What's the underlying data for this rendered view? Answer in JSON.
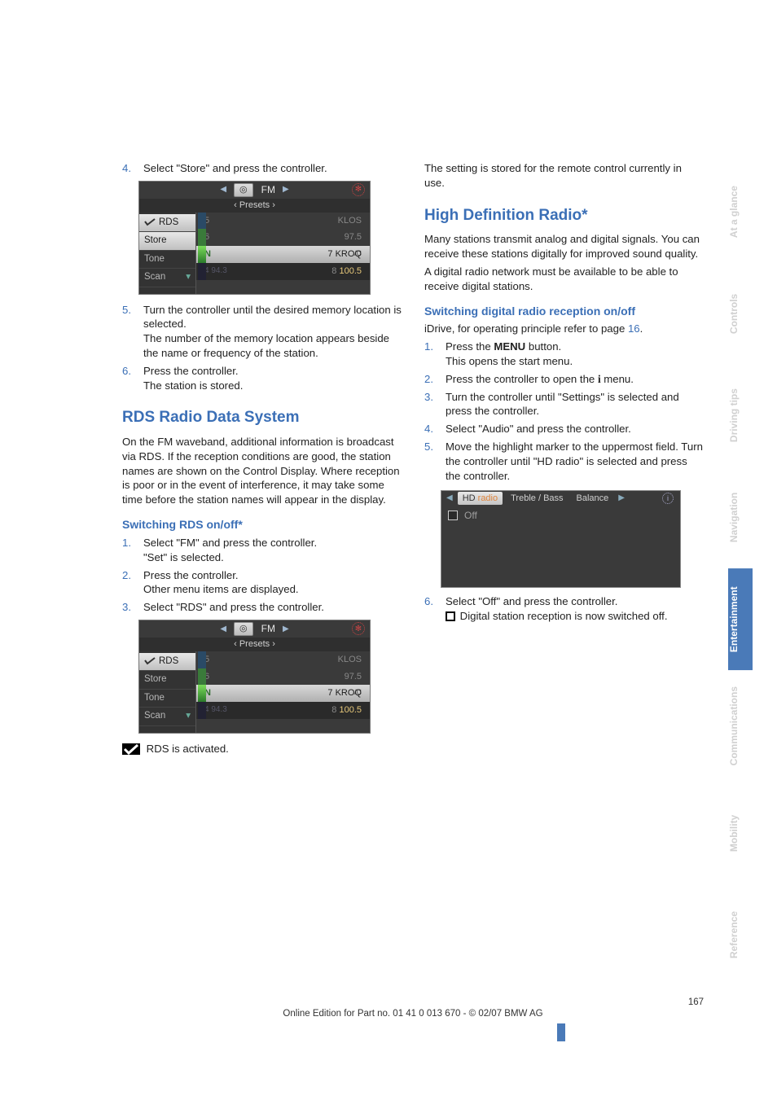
{
  "left": {
    "step4_num": "4.",
    "step4_text": "Select \"Store\" and press the controller.",
    "shot1": {
      "band_icon_text": "◎",
      "fm": "FM",
      "presets": "‹  Presets  ›",
      "sidebar": [
        "RDS",
        "Store",
        "Tone",
        "Scan"
      ],
      "rows": [
        {
          "n": "5",
          "name": "KLOS"
        },
        {
          "n": "6",
          "name": "97.5"
        },
        {
          "n": "7",
          "name": "KROQ"
        },
        {
          "n": "8",
          "name": "100.5"
        }
      ]
    },
    "step5_num": "5.",
    "step5_a": "Turn the controller until the desired memory location is selected.",
    "step5_b": "The number of the memory location appears beside the name or frequency of the station.",
    "step6_num": "6.",
    "step6_a": "Press the controller.",
    "step6_b": "The station is stored.",
    "h2_rds": "RDS Radio Data System",
    "rds_para": "On the FM waveband, additional information is broadcast via RDS. If the reception conditions are good, the station names are shown on the Control Display. Where reception is poor or in the event of interference, it may take some time before the station names will appear in the display.",
    "h3_rds_switch": "Switching RDS on/off*",
    "rds1_num": "1.",
    "rds1_a": "Select \"FM\" and press the controller.",
    "rds1_b": "\"Set\" is selected.",
    "rds2_num": "2.",
    "rds2_a": "Press the controller.",
    "rds2_b": "Other menu items are displayed.",
    "rds3_num": "3.",
    "rds3_a": "Select \"RDS\" and press the controller.",
    "shot2_sidebar": [
      "RDS",
      "Store",
      "Tone",
      "Scan"
    ],
    "rds_activated": " RDS is activated."
  },
  "right": {
    "para_top": "The setting is stored for the remote control currently in use.",
    "h2_hd": "High Definition Radio*",
    "hd_p1": "Many stations transmit analog and digital signals. You can receive these stations digitally for improved sound quality.",
    "hd_p2": "A digital radio network must be available to be able to receive digital stations.",
    "h3_hd_switch": "Switching digital radio reception on/off",
    "idrive_prefix": "iDrive, for operating principle refer to page ",
    "idrive_page": "16",
    "idrive_suffix": ".",
    "s1_num": "1.",
    "s1_a_prefix": "Press the ",
    "s1_a_menu": "MENU",
    "s1_a_suffix": " button.",
    "s1_b": "This opens the start menu.",
    "s2_num": "2.",
    "s2_prefix": "Press the controller to open the ",
    "s2_icon": "i",
    "s2_suffix": " menu.",
    "s3_num": "3.",
    "s3": "Turn the controller until \"Settings\" is selected and press the controller.",
    "s4_num": "4.",
    "s4": "Select \"Audio\" and press the controller.",
    "s5_num": "5.",
    "s5": "Move the highlight marker to the uppermost field. Turn the controller until \"HD radio\" is selected and press the controller.",
    "hdshot": {
      "tab1_a": "HD ",
      "tab1_b": "radio",
      "tab2": "Treble / Bass",
      "tab3": "Balance",
      "off": "Off"
    },
    "s6_num": "6.",
    "s6_a": "Select \"Off\" and press the controller.",
    "s6_b": " Digital station reception is now switched off."
  },
  "tabs": [
    "Reference",
    "Mobility",
    "Communications",
    "Entertainment",
    "Navigation",
    "Driving tips",
    "Controls",
    "At a glance"
  ],
  "footer": {
    "page": "167",
    "line": "Online Edition for Part no. 01 41 0 013 670 - © 02/07 BMW AG"
  }
}
